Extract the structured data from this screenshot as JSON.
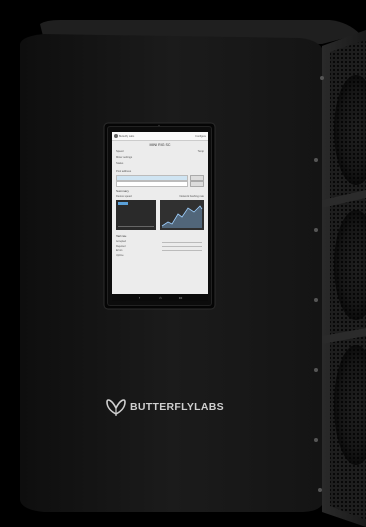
{
  "device": {
    "brand_name": "BUTTERFLYLABS"
  },
  "screen": {
    "top_bar": {
      "app_name": "Butterfly Labs",
      "action": "Configure"
    },
    "header": "MINI RIG SC",
    "rows": {
      "speed_label": "Speed",
      "temp_label": "Temp",
      "settings_label": "Miner settings",
      "status_label": "Status",
      "pool_label": "Pool address"
    },
    "section_title": "Summary",
    "panel_left_label": "Device speed",
    "panel_right_label": "Network hashing rate",
    "table_heading": "Hash rate",
    "table_rows": [
      "Accepted",
      "Rejected",
      "Errors",
      "Uptime"
    ]
  },
  "colors": {
    "body": "#151515",
    "body_edge": "#3a3a3a",
    "brand_text": "#cfcfcf",
    "chart_line": "#9fd0ff"
  }
}
